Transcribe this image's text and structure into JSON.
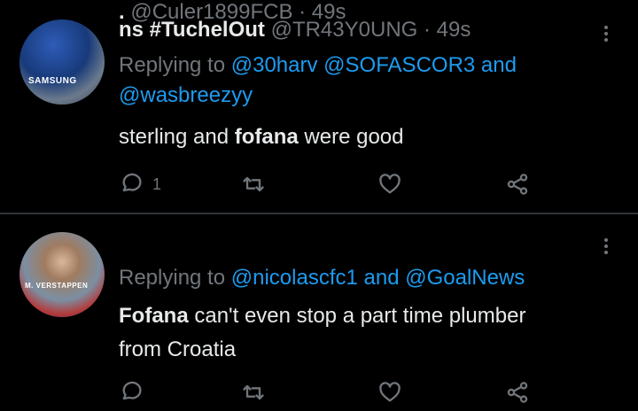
{
  "tweets": [
    {
      "name": "ns #TuchelOut",
      "handle": "@TR43Y0UNG",
      "dot": "·",
      "time": "49s",
      "avatar_text": "SAMSUNG",
      "replying_prefix": "Replying to",
      "mention_1": "@30harv",
      "mention_2": "@SOFASCOR3",
      "and": "and",
      "mention_3": "@wasbreezyy",
      "body_part1": "sterling and ",
      "body_bold": "fofana",
      "body_part2": " were good",
      "reply_count": "1",
      "icons": [
        "reply-icon",
        "retweet-icon",
        "like-icon",
        "share-icon"
      ]
    },
    {
      "name": ".",
      "handle": "@Culer1899FCB",
      "dot": "·",
      "time": "49s",
      "avatar_text": "M. VERSTAPPEN",
      "replying_prefix": "Replying to",
      "mention_1": "@nicolascfc1",
      "and": "and",
      "mention_2": "@GoalNews",
      "body_bold": "Fofana",
      "body_part1": " can't even stop a part time plumber",
      "body_part2": "from Croatia",
      "reply_count": "",
      "icons": [
        "reply-icon",
        "retweet-icon",
        "like-icon",
        "share-icon"
      ]
    }
  ],
  "colors": {
    "background": "#000000",
    "text": "#e7e9ea",
    "muted": "#71767b",
    "accent": "#1d9bf0",
    "divider": "#2f3336"
  }
}
